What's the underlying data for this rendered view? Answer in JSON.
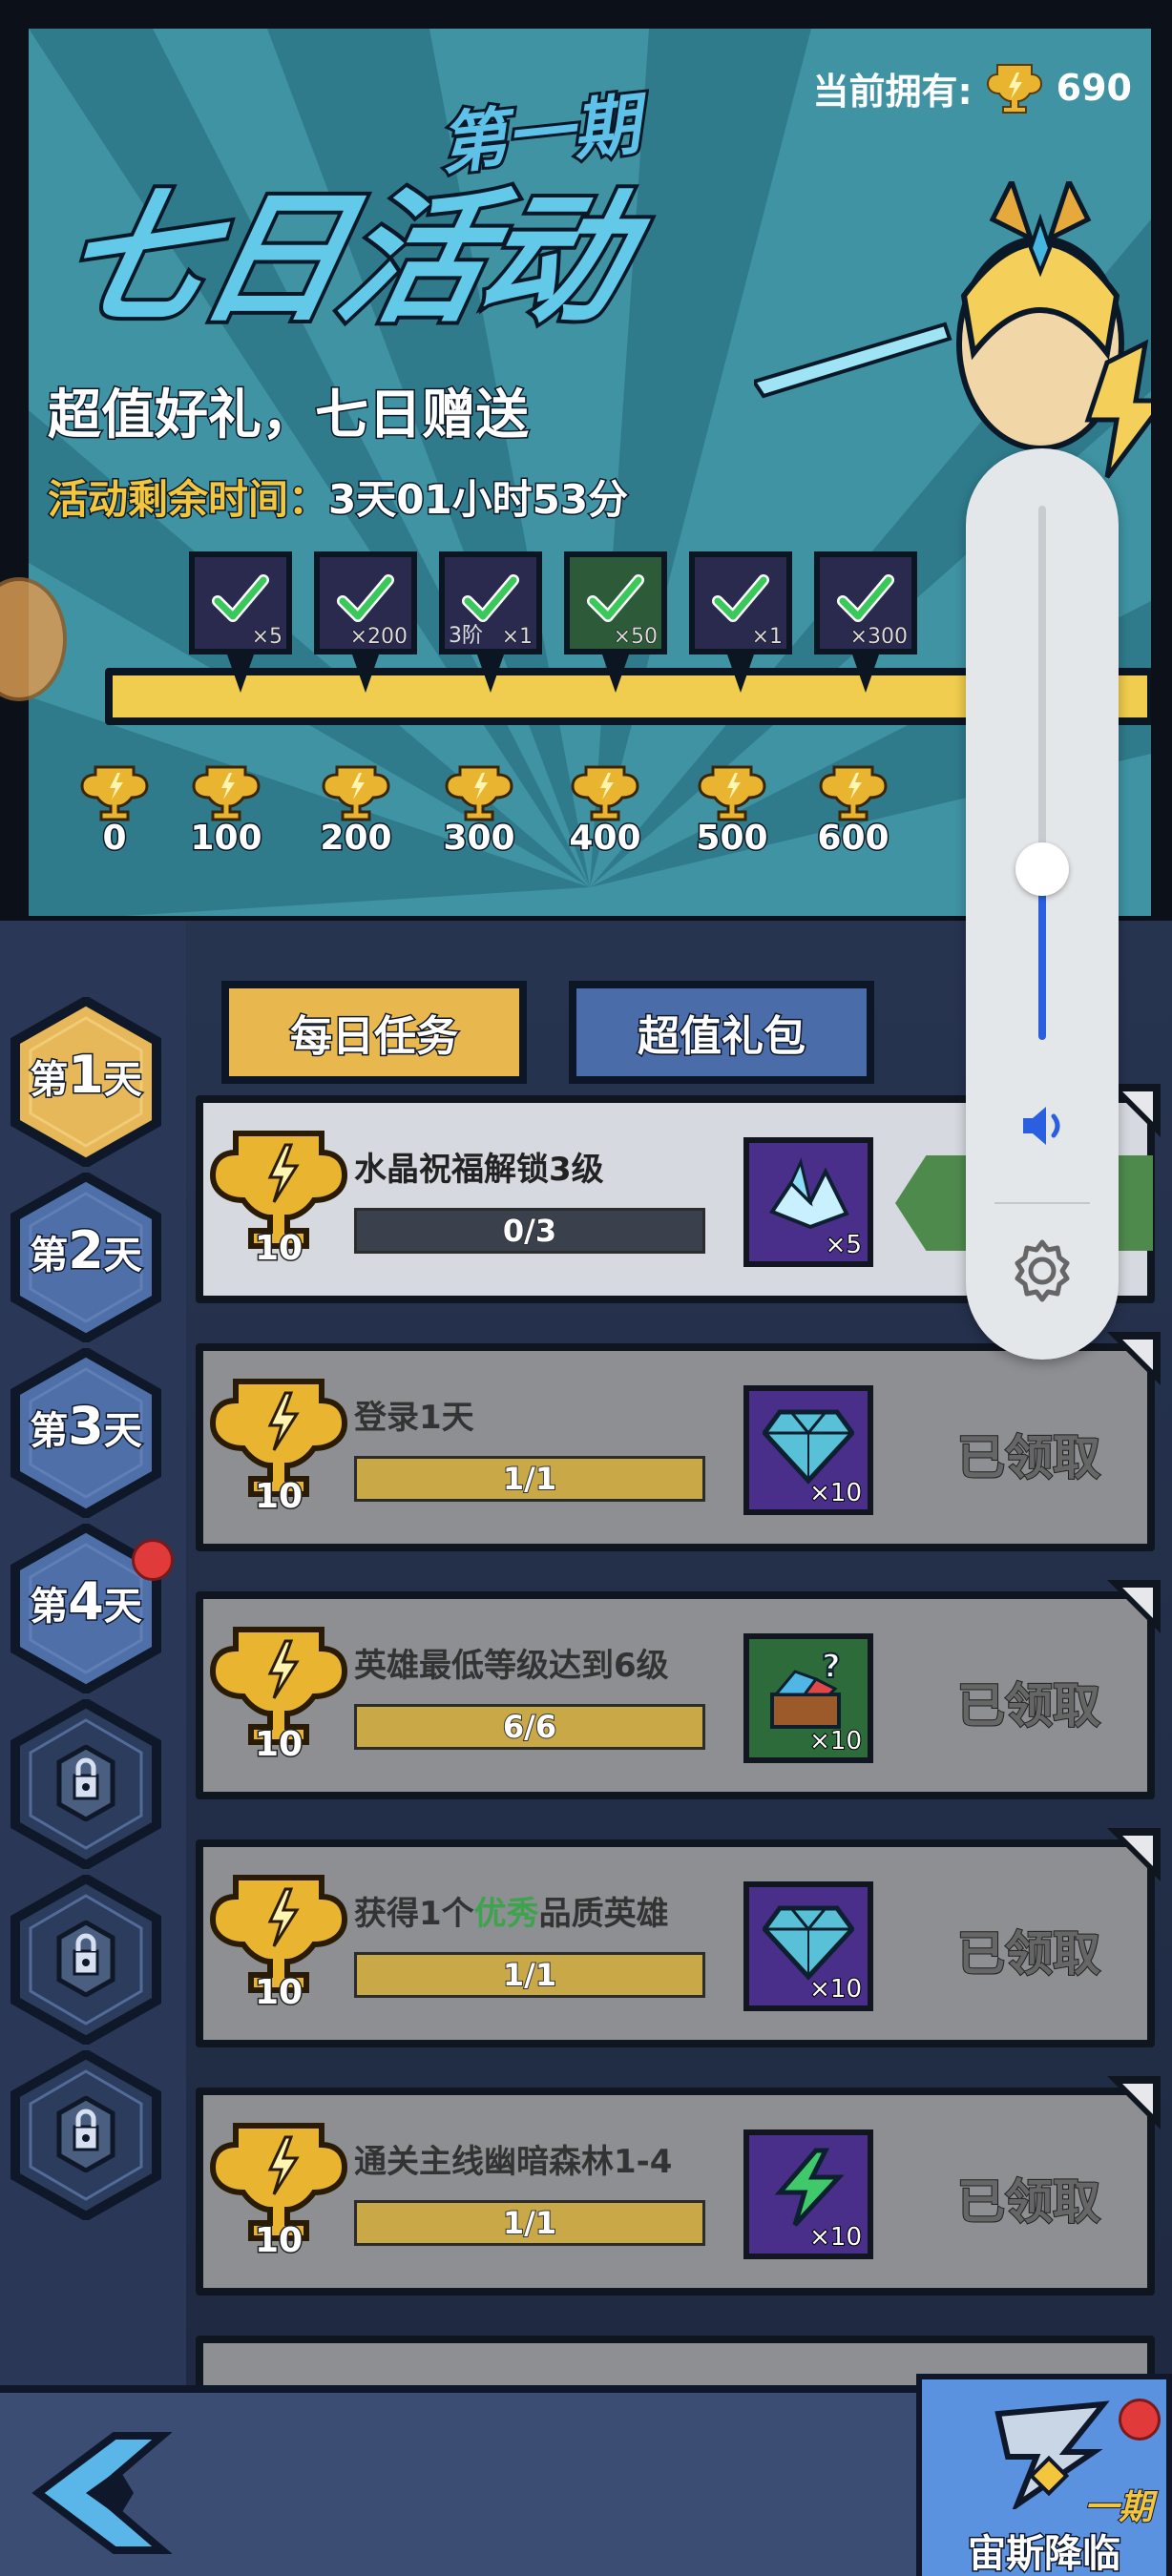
{
  "header": {
    "title_period": "第一期",
    "title_main": "七日活动",
    "slogan": "超值好礼，七日赠送",
    "remaining_label": "活动剩余时间：",
    "remaining_value": "3天01小时53分",
    "owned_label": "当前拥有:",
    "owned_value": "690"
  },
  "progress": {
    "rewards": [
      {
        "count": "×5",
        "tier": "",
        "claimed": true,
        "color": "purple"
      },
      {
        "count": "×200",
        "tier": "",
        "claimed": true,
        "color": "purple"
      },
      {
        "count": "×1",
        "tier": "3阶",
        "claimed": true,
        "color": "purple"
      },
      {
        "count": "×50",
        "tier": "",
        "claimed": true,
        "color": "green"
      },
      {
        "count": "×1",
        "tier": "",
        "claimed": true,
        "color": "purple"
      },
      {
        "count": "×300",
        "tier": "",
        "claimed": true,
        "color": "purple"
      }
    ],
    "milestones": [
      "0",
      "100",
      "200",
      "300",
      "400",
      "500",
      "600"
    ]
  },
  "days": [
    {
      "prefix": "第",
      "num": "1",
      "suffix": "天",
      "state": "active"
    },
    {
      "prefix": "第",
      "num": "2",
      "suffix": "天",
      "state": "open"
    },
    {
      "prefix": "第",
      "num": "3",
      "suffix": "天",
      "state": "open"
    },
    {
      "prefix": "第",
      "num": "4",
      "suffix": "天",
      "state": "open",
      "badge": true
    },
    {
      "state": "locked"
    },
    {
      "state": "locked"
    },
    {
      "state": "locked"
    }
  ],
  "tabs": {
    "daily": "每日任务",
    "gift": "超值礼包"
  },
  "tasks": [
    {
      "title": "水晶祝福解锁3级",
      "progress": "0/3",
      "points": "10",
      "item_count": "×5",
      "status": ""
    },
    {
      "title": "登录1天",
      "progress": "1/1",
      "points": "10",
      "item_count": "×10",
      "status": "已领取"
    },
    {
      "title": "英雄最低等级达到6级",
      "progress": "6/6",
      "points": "10",
      "item_count": "×10",
      "status": "已领取"
    },
    {
      "title_pre": "获得1个",
      "title_hl": "优秀",
      "title_post": "品质英雄",
      "progress": "1/1",
      "points": "10",
      "item_count": "×10",
      "status": "已领取"
    },
    {
      "title": "通关主线幽暗森林1-4",
      "progress": "1/1",
      "points": "10",
      "item_count": "×10",
      "status": "已领取"
    }
  ],
  "bottom": {
    "event_label": "宙斯降临",
    "event_period": "一期"
  },
  "colors": {
    "banner_bg": "#3f93a3",
    "gold": "#f0cd4e",
    "accent_blue": "#2a5fe0",
    "highlight_green": "#3da44d"
  },
  "volume_level": 0.32
}
